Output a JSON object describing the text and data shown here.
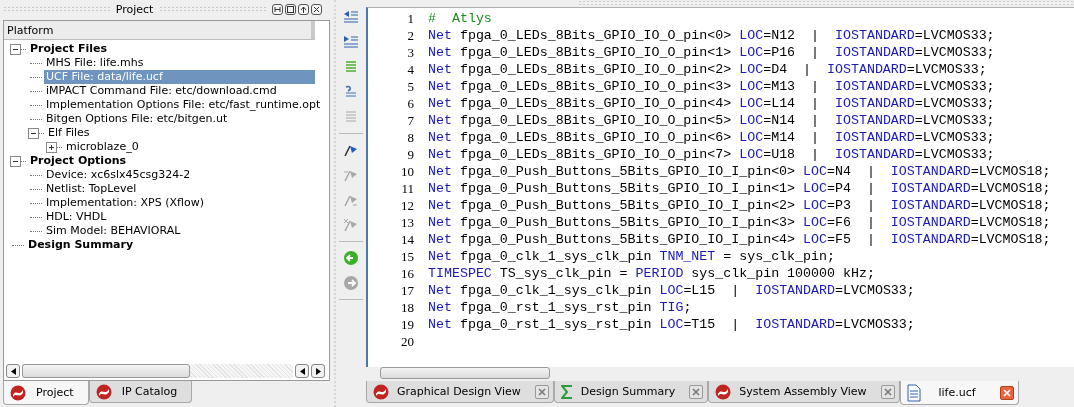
{
  "project_panel": {
    "title": "Project",
    "header": "Platform",
    "tree": [
      {
        "label": "Project Files",
        "expanded": true,
        "selected": false,
        "children": [
          {
            "label": "MHS File: life.mhs",
            "selected": false
          },
          {
            "label": "UCF File: data/life.ucf",
            "selected": true
          },
          {
            "label": "iMPACT Command File: etc/download.cmd",
            "selected": false
          },
          {
            "label": "Implementation Options File: etc/fast_runtime.opt",
            "selected": false
          },
          {
            "label": "Bitgen Options File: etc/bitgen.ut",
            "selected": false
          },
          {
            "label": "Elf Files",
            "expanded": true,
            "selected": false,
            "children": [
              {
                "label": "microblaze_0",
                "expanded": false,
                "selected": false
              }
            ]
          }
        ]
      },
      {
        "label": "Project Options",
        "expanded": true,
        "selected": false,
        "children": [
          {
            "label": "Device: xc6slx45csg324-2",
            "selected": false
          },
          {
            "label": "Netlist: TopLevel",
            "selected": false
          },
          {
            "label": "Implementation: XPS (Xflow)",
            "selected": false
          },
          {
            "label": "HDL: VHDL",
            "selected": false
          },
          {
            "label": "Sim Model: BEHAVIORAL",
            "selected": false
          }
        ]
      },
      {
        "label": "Design Summary",
        "selected": false
      }
    ],
    "tabs": [
      {
        "label": "Project",
        "selected": true
      },
      {
        "label": "IP Catalog",
        "selected": false
      }
    ]
  },
  "toolbar": [
    {
      "kind": "outdent",
      "disabled": false
    },
    {
      "kind": "indent",
      "disabled": false
    },
    {
      "kind": "list",
      "disabled": false
    },
    {
      "kind": "comment",
      "disabled": false
    },
    {
      "kind": "uncomment",
      "disabled": true
    },
    {
      "kind": "bookmark",
      "disabled": false
    },
    {
      "kind": "bookmark-prev",
      "disabled": true
    },
    {
      "kind": "bookmark-next",
      "disabled": true
    },
    {
      "kind": "bookmark-clear",
      "disabled": true
    },
    {
      "kind": "back",
      "disabled": false
    },
    {
      "kind": "forward",
      "disabled": true
    }
  ],
  "editor": {
    "lines": [
      {
        "number": "1",
        "parts": [
          {
            "kind": "comment",
            "text": "#  Atlys"
          }
        ]
      },
      {
        "number": "2",
        "parts": [
          {
            "kind": "keyword",
            "text": "Net"
          },
          {
            "kind": "plain",
            "text": " fpga_0_LEDs_8Bits_GPIO_IO_O_pin<0> "
          },
          {
            "kind": "keyword",
            "text": "LOC"
          },
          {
            "kind": "plain",
            "text": "=N12  |  "
          },
          {
            "kind": "keyword",
            "text": "IOSTANDARD"
          },
          {
            "kind": "plain",
            "text": "=LVCMOS33;"
          }
        ]
      },
      {
        "number": "3",
        "parts": [
          {
            "kind": "keyword",
            "text": "Net"
          },
          {
            "kind": "plain",
            "text": " fpga_0_LEDs_8Bits_GPIO_IO_O_pin<1> "
          },
          {
            "kind": "keyword",
            "text": "LOC"
          },
          {
            "kind": "plain",
            "text": "=P16  |  "
          },
          {
            "kind": "keyword",
            "text": "IOSTANDARD"
          },
          {
            "kind": "plain",
            "text": "=LVCMOS33;"
          }
        ]
      },
      {
        "number": "4",
        "parts": [
          {
            "kind": "keyword",
            "text": "Net"
          },
          {
            "kind": "plain",
            "text": " fpga_0_LEDs_8Bits_GPIO_IO_O_pin<2> "
          },
          {
            "kind": "keyword",
            "text": "LOC"
          },
          {
            "kind": "plain",
            "text": "=D4  |  "
          },
          {
            "kind": "keyword",
            "text": "IOSTANDARD"
          },
          {
            "kind": "plain",
            "text": "=LVCMOS33;"
          }
        ]
      },
      {
        "number": "5",
        "parts": [
          {
            "kind": "keyword",
            "text": "Net"
          },
          {
            "kind": "plain",
            "text": " fpga_0_LEDs_8Bits_GPIO_IO_O_pin<3> "
          },
          {
            "kind": "keyword",
            "text": "LOC"
          },
          {
            "kind": "plain",
            "text": "=M13  |  "
          },
          {
            "kind": "keyword",
            "text": "IOSTANDARD"
          },
          {
            "kind": "plain",
            "text": "=LVCMOS33;"
          }
        ]
      },
      {
        "number": "6",
        "parts": [
          {
            "kind": "keyword",
            "text": "Net"
          },
          {
            "kind": "plain",
            "text": " fpga_0_LEDs_8Bits_GPIO_IO_O_pin<4> "
          },
          {
            "kind": "keyword",
            "text": "LOC"
          },
          {
            "kind": "plain",
            "text": "=L14  |  "
          },
          {
            "kind": "keyword",
            "text": "IOSTANDARD"
          },
          {
            "kind": "plain",
            "text": "=LVCMOS33;"
          }
        ]
      },
      {
        "number": "7",
        "parts": [
          {
            "kind": "keyword",
            "text": "Net"
          },
          {
            "kind": "plain",
            "text": " fpga_0_LEDs_8Bits_GPIO_IO_O_pin<5> "
          },
          {
            "kind": "keyword",
            "text": "LOC"
          },
          {
            "kind": "plain",
            "text": "=N14  |  "
          },
          {
            "kind": "keyword",
            "text": "IOSTANDARD"
          },
          {
            "kind": "plain",
            "text": "=LVCMOS33;"
          }
        ]
      },
      {
        "number": "8",
        "parts": [
          {
            "kind": "keyword",
            "text": "Net"
          },
          {
            "kind": "plain",
            "text": " fpga_0_LEDs_8Bits_GPIO_IO_O_pin<6> "
          },
          {
            "kind": "keyword",
            "text": "LOC"
          },
          {
            "kind": "plain",
            "text": "=M14  |  "
          },
          {
            "kind": "keyword",
            "text": "IOSTANDARD"
          },
          {
            "kind": "plain",
            "text": "=LVCMOS33;"
          }
        ]
      },
      {
        "number": "9",
        "parts": [
          {
            "kind": "keyword",
            "text": "Net"
          },
          {
            "kind": "plain",
            "text": " fpga_0_LEDs_8Bits_GPIO_IO_O_pin<7> "
          },
          {
            "kind": "keyword",
            "text": "LOC"
          },
          {
            "kind": "plain",
            "text": "=U18  |  "
          },
          {
            "kind": "keyword",
            "text": "IOSTANDARD"
          },
          {
            "kind": "plain",
            "text": "=LVCMOS33;"
          }
        ]
      },
      {
        "number": "10",
        "parts": [
          {
            "kind": "keyword",
            "text": "Net"
          },
          {
            "kind": "plain",
            "text": " fpga_0_Push_Buttons_5Bits_GPIO_IO_I_pin<0> "
          },
          {
            "kind": "keyword",
            "text": "LOC"
          },
          {
            "kind": "plain",
            "text": "=N4  |  "
          },
          {
            "kind": "keyword",
            "text": "IOSTANDARD"
          },
          {
            "kind": "plain",
            "text": "=LVCMOS18;"
          }
        ]
      },
      {
        "number": "11",
        "parts": [
          {
            "kind": "keyword",
            "text": "Net"
          },
          {
            "kind": "plain",
            "text": " fpga_0_Push_Buttons_5Bits_GPIO_IO_I_pin<1> "
          },
          {
            "kind": "keyword",
            "text": "LOC"
          },
          {
            "kind": "plain",
            "text": "=P4  |  "
          },
          {
            "kind": "keyword",
            "text": "IOSTANDARD"
          },
          {
            "kind": "plain",
            "text": "=LVCMOS18;"
          }
        ]
      },
      {
        "number": "12",
        "parts": [
          {
            "kind": "keyword",
            "text": "Net"
          },
          {
            "kind": "plain",
            "text": " fpga_0_Push_Buttons_5Bits_GPIO_IO_I_pin<2> "
          },
          {
            "kind": "keyword",
            "text": "LOC"
          },
          {
            "kind": "plain",
            "text": "=P3  |  "
          },
          {
            "kind": "keyword",
            "text": "IOSTANDARD"
          },
          {
            "kind": "plain",
            "text": "=LVCMOS18;"
          }
        ]
      },
      {
        "number": "13",
        "parts": [
          {
            "kind": "keyword",
            "text": "Net"
          },
          {
            "kind": "plain",
            "text": " fpga_0_Push_Buttons_5Bits_GPIO_IO_I_pin<3> "
          },
          {
            "kind": "keyword",
            "text": "LOC"
          },
          {
            "kind": "plain",
            "text": "=F6  |  "
          },
          {
            "kind": "keyword",
            "text": "IOSTANDARD"
          },
          {
            "kind": "plain",
            "text": "=LVCMOS18;"
          }
        ]
      },
      {
        "number": "14",
        "parts": [
          {
            "kind": "keyword",
            "text": "Net"
          },
          {
            "kind": "plain",
            "text": " fpga_0_Push_Buttons_5Bits_GPIO_IO_I_pin<4> "
          },
          {
            "kind": "keyword",
            "text": "LOC"
          },
          {
            "kind": "plain",
            "text": "=F5  |  "
          },
          {
            "kind": "keyword",
            "text": "IOSTANDARD"
          },
          {
            "kind": "plain",
            "text": "=LVCMOS18;"
          }
        ]
      },
      {
        "number": "15",
        "parts": [
          {
            "kind": "keyword",
            "text": "Net"
          },
          {
            "kind": "plain",
            "text": " fpga_0_clk_1_sys_clk_pin "
          },
          {
            "kind": "keyword",
            "text": "TNM_NET"
          },
          {
            "kind": "plain",
            "text": " = sys_clk_pin;"
          }
        ]
      },
      {
        "number": "16",
        "parts": [
          {
            "kind": "keyword",
            "text": "TIMESPEC"
          },
          {
            "kind": "plain",
            "text": " TS_sys_clk_pin = "
          },
          {
            "kind": "keyword",
            "text": "PERIOD"
          },
          {
            "kind": "plain",
            "text": " sys_clk_pin 100000 kHz;"
          }
        ]
      },
      {
        "number": "17",
        "parts": [
          {
            "kind": "keyword",
            "text": "Net"
          },
          {
            "kind": "plain",
            "text": " fpga_0_clk_1_sys_clk_pin "
          },
          {
            "kind": "keyword",
            "text": "LOC"
          },
          {
            "kind": "plain",
            "text": "=L15  |  "
          },
          {
            "kind": "keyword",
            "text": "IOSTANDARD"
          },
          {
            "kind": "plain",
            "text": "=LVCMOS33;"
          }
        ]
      },
      {
        "number": "18",
        "parts": [
          {
            "kind": "keyword",
            "text": "Net"
          },
          {
            "kind": "plain",
            "text": " fpga_0_rst_1_sys_rst_pin "
          },
          {
            "kind": "keyword",
            "text": "TIG"
          },
          {
            "kind": "plain",
            "text": ";"
          }
        ]
      },
      {
        "number": "19",
        "parts": [
          {
            "kind": "keyword",
            "text": "Net"
          },
          {
            "kind": "plain",
            "text": " fpga_0_rst_1_sys_rst_pin "
          },
          {
            "kind": "keyword",
            "text": "LOC"
          },
          {
            "kind": "plain",
            "text": "=T15  |  "
          },
          {
            "kind": "keyword",
            "text": "IOSTANDARD"
          },
          {
            "kind": "plain",
            "text": "=LVCMOS33;"
          }
        ]
      },
      {
        "number": "20"
      }
    ],
    "tabs": [
      {
        "label": "Graphical Design View",
        "kind": "design",
        "selected": false
      },
      {
        "label": "Design Summary",
        "kind": "summary",
        "selected": false
      },
      {
        "label": "System Assembly View",
        "kind": "design",
        "selected": false
      },
      {
        "label": "life.ucf",
        "kind": "file",
        "selected": true
      }
    ]
  }
}
